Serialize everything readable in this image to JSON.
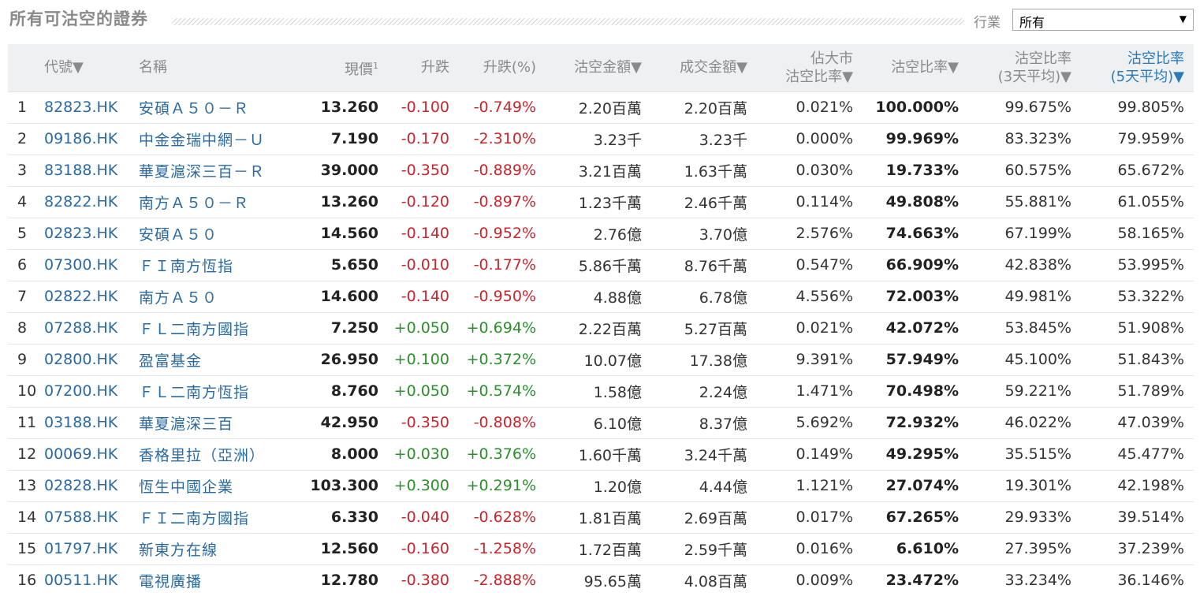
{
  "title": "所有可沽空的證券",
  "filter": {
    "label": "行業",
    "selected": "所有"
  },
  "headers": {
    "code": "代號▼",
    "name": "名稱",
    "price": "現價",
    "price_sup": "1",
    "change": "升跌",
    "change_pct": "升跌(%)",
    "short_amount": "沽空金額▼",
    "turnover": "成交金額▼",
    "market_ratio_line1": "佔大市",
    "market_ratio_line2": "沽空比率▼",
    "short_ratio": "沽空比率▼",
    "avg3_line1": "沽空比率",
    "avg3_line2": "(3天平均)▼",
    "avg5_line1": "沽空比率",
    "avg5_line2": "(5天平均)▼"
  },
  "rows": [
    {
      "n": "1",
      "code": "82823.HK",
      "name": "安碩Ａ５０－Ｒ",
      "price": "13.260",
      "chg": "-0.100",
      "pct": "-0.749%",
      "dir": "neg",
      "short": "2.20百萬",
      "turnover": "2.20百萬",
      "mkt": "0.021%",
      "ratio": "100.000%",
      "avg3": "99.675%",
      "avg5": "99.805%"
    },
    {
      "n": "2",
      "code": "09186.HK",
      "name": "中金金瑞中網－Ｕ",
      "price": "7.190",
      "chg": "-0.170",
      "pct": "-2.310%",
      "dir": "neg",
      "short": "3.23千",
      "turnover": "3.23千",
      "mkt": "0.000%",
      "ratio": "99.969%",
      "avg3": "83.323%",
      "avg5": "79.959%"
    },
    {
      "n": "3",
      "code": "83188.HK",
      "name": "華夏滬深三百－Ｒ",
      "price": "39.000",
      "chg": "-0.350",
      "pct": "-0.889%",
      "dir": "neg",
      "short": "3.21百萬",
      "turnover": "1.63千萬",
      "mkt": "0.030%",
      "ratio": "19.733%",
      "avg3": "60.575%",
      "avg5": "65.672%"
    },
    {
      "n": "4",
      "code": "82822.HK",
      "name": "南方Ａ５０－Ｒ",
      "price": "13.260",
      "chg": "-0.120",
      "pct": "-0.897%",
      "dir": "neg",
      "short": "1.23千萬",
      "turnover": "2.46千萬",
      "mkt": "0.114%",
      "ratio": "49.808%",
      "avg3": "55.881%",
      "avg5": "61.055%"
    },
    {
      "n": "5",
      "code": "02823.HK",
      "name": "安碩Ａ５０",
      "price": "14.560",
      "chg": "-0.140",
      "pct": "-0.952%",
      "dir": "neg",
      "short": "2.76億",
      "turnover": "3.70億",
      "mkt": "2.576%",
      "ratio": "74.663%",
      "avg3": "67.199%",
      "avg5": "58.165%"
    },
    {
      "n": "6",
      "code": "07300.HK",
      "name": "ＦＩ南方恆指",
      "price": "5.650",
      "chg": "-0.010",
      "pct": "-0.177%",
      "dir": "neg",
      "short": "5.86千萬",
      "turnover": "8.76千萬",
      "mkt": "0.547%",
      "ratio": "66.909%",
      "avg3": "42.838%",
      "avg5": "53.995%"
    },
    {
      "n": "7",
      "code": "02822.HK",
      "name": "南方Ａ５０",
      "price": "14.600",
      "chg": "-0.140",
      "pct": "-0.950%",
      "dir": "neg",
      "short": "4.88億",
      "turnover": "6.78億",
      "mkt": "4.556%",
      "ratio": "72.003%",
      "avg3": "49.981%",
      "avg5": "53.322%"
    },
    {
      "n": "8",
      "code": "07288.HK",
      "name": "ＦＬ二南方國指",
      "price": "7.250",
      "chg": "+0.050",
      "pct": "+0.694%",
      "dir": "pos",
      "short": "2.22百萬",
      "turnover": "5.27百萬",
      "mkt": "0.021%",
      "ratio": "42.072%",
      "avg3": "53.845%",
      "avg5": "51.908%"
    },
    {
      "n": "9",
      "code": "02800.HK",
      "name": "盈富基金",
      "price": "26.950",
      "chg": "+0.100",
      "pct": "+0.372%",
      "dir": "pos",
      "short": "10.07億",
      "turnover": "17.38億",
      "mkt": "9.391%",
      "ratio": "57.949%",
      "avg3": "45.100%",
      "avg5": "51.843%"
    },
    {
      "n": "10",
      "code": "07200.HK",
      "name": "ＦＬ二南方恆指",
      "price": "8.760",
      "chg": "+0.050",
      "pct": "+0.574%",
      "dir": "pos",
      "short": "1.58億",
      "turnover": "2.24億",
      "mkt": "1.471%",
      "ratio": "70.498%",
      "avg3": "59.221%",
      "avg5": "51.789%"
    },
    {
      "n": "11",
      "code": "03188.HK",
      "name": "華夏滬深三百",
      "price": "42.950",
      "chg": "-0.350",
      "pct": "-0.808%",
      "dir": "neg",
      "short": "6.10億",
      "turnover": "8.37億",
      "mkt": "5.692%",
      "ratio": "72.932%",
      "avg3": "46.022%",
      "avg5": "47.039%"
    },
    {
      "n": "12",
      "code": "00069.HK",
      "name": "香格里拉（亞洲）",
      "price": "8.000",
      "chg": "+0.030",
      "pct": "+0.376%",
      "dir": "pos",
      "short": "1.60千萬",
      "turnover": "3.24千萬",
      "mkt": "0.149%",
      "ratio": "49.295%",
      "avg3": "35.515%",
      "avg5": "45.477%"
    },
    {
      "n": "13",
      "code": "02828.HK",
      "name": "恆生中國企業",
      "price": "103.300",
      "chg": "+0.300",
      "pct": "+0.291%",
      "dir": "pos",
      "short": "1.20億",
      "turnover": "4.44億",
      "mkt": "1.121%",
      "ratio": "27.074%",
      "avg3": "19.301%",
      "avg5": "42.198%"
    },
    {
      "n": "14",
      "code": "07588.HK",
      "name": "ＦＩ二南方國指",
      "price": "6.330",
      "chg": "-0.040",
      "pct": "-0.628%",
      "dir": "neg",
      "short": "1.81百萬",
      "turnover": "2.69百萬",
      "mkt": "0.017%",
      "ratio": "67.265%",
      "avg3": "29.933%",
      "avg5": "39.514%"
    },
    {
      "n": "15",
      "code": "01797.HK",
      "name": "新東方在線",
      "price": "12.560",
      "chg": "-0.160",
      "pct": "-1.258%",
      "dir": "neg",
      "short": "1.72百萬",
      "turnover": "2.59千萬",
      "mkt": "0.016%",
      "ratio": "6.610%",
      "avg3": "27.395%",
      "avg5": "37.239%"
    },
    {
      "n": "16",
      "code": "00511.HK",
      "name": "電視廣播",
      "price": "12.780",
      "chg": "-0.380",
      "pct": "-2.888%",
      "dir": "neg",
      "short": "95.65萬",
      "turnover": "4.08百萬",
      "mkt": "0.009%",
      "ratio": "23.472%",
      "avg3": "33.234%",
      "avg5": "36.146%"
    }
  ]
}
